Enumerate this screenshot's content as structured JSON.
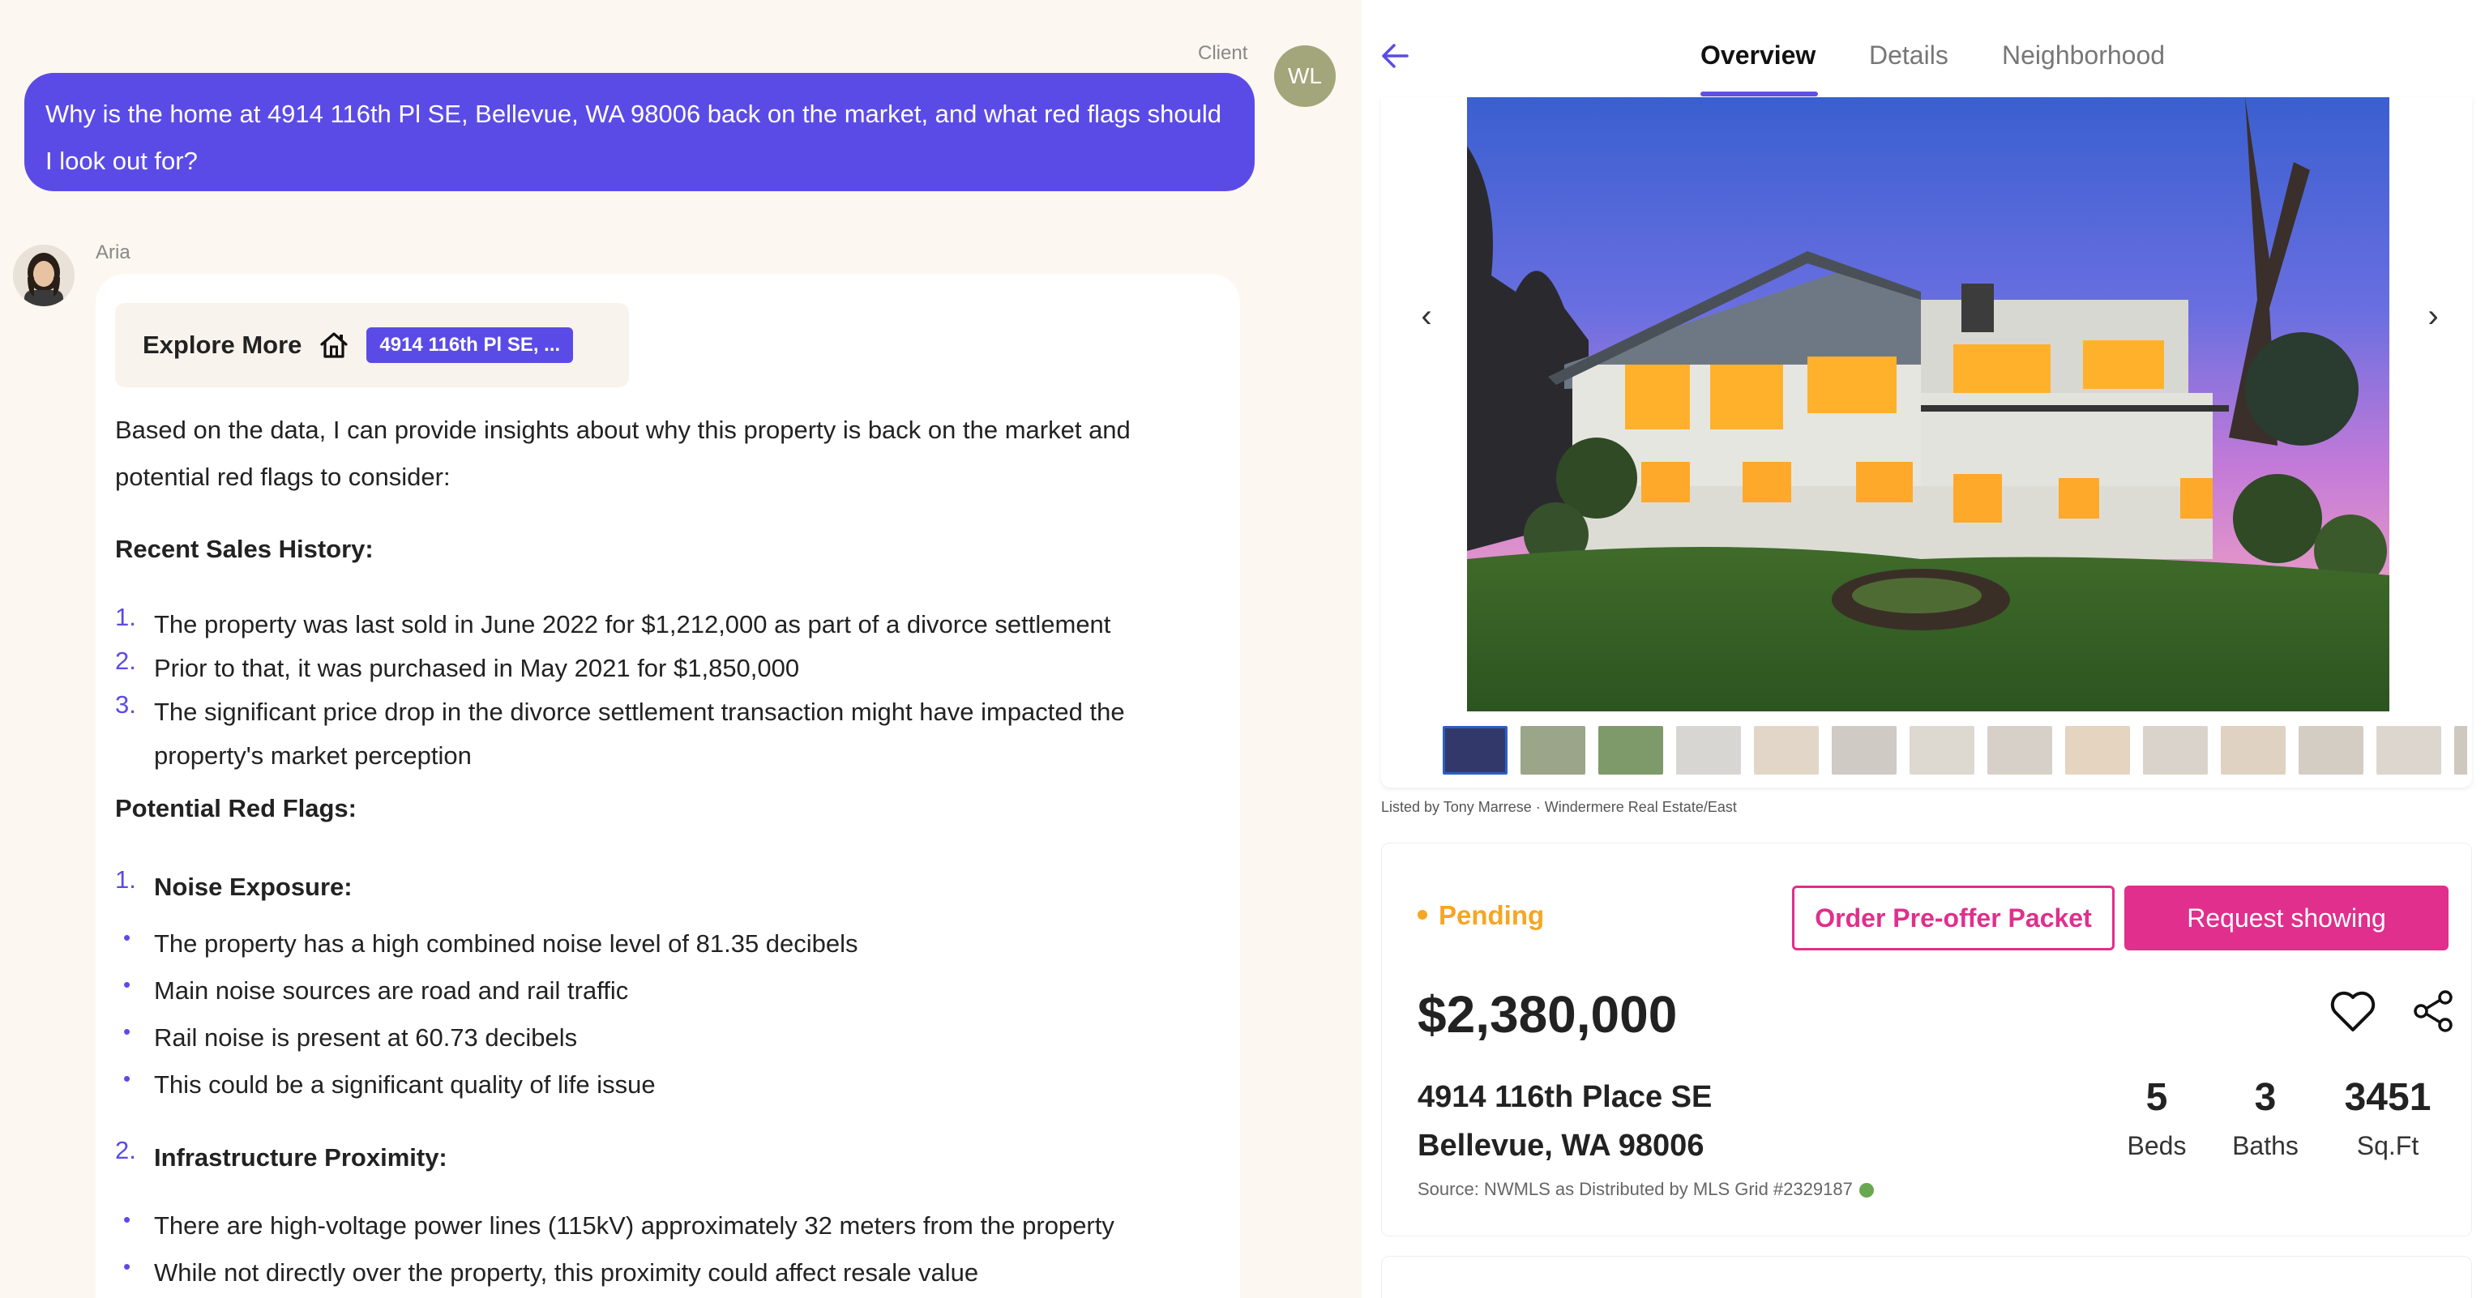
{
  "chat": {
    "client_label": "Client",
    "client_initials": "WL",
    "question": "Why is the home at 4914 116th Pl SE, Bellevue, WA 98006 back on the market, and what red flags should I look out for?",
    "assistant_name": "Aria",
    "explore": {
      "label": "Explore More",
      "chip": "4914 116th Pl SE, ..."
    },
    "intro": "Based on the data, I can provide insights about why this property is back on the market and potential red flags to consider:",
    "sales_heading": "Recent Sales History:",
    "sales_items": [
      {
        "n": "1.",
        "text": "The property was last sold in June 2022 for $1,212,000 as part of a divorce settlement"
      },
      {
        "n": "2.",
        "text": "Prior to that, it was purchased in May 2021 for $1,850,000"
      },
      {
        "n": "3.",
        "text": "The significant price drop in the divorce settlement transaction might have impacted the property's market perception"
      }
    ],
    "flags_heading": "Potential Red Flags:",
    "flag1": {
      "n": "1.",
      "title": "Noise Exposure:"
    },
    "flag1_bullets": [
      "The property has a high combined noise level of 81.35 decibels",
      "Main noise sources are road and rail traffic",
      "Rail noise is present at 60.73 decibels",
      "This could be a significant quality of life issue"
    ],
    "flag2": {
      "n": "2.",
      "title": "Infrastructure Proximity:"
    },
    "flag2_bullets": [
      "There are high-voltage power lines (115kV) approximately 32 meters from the property",
      "While not directly over the property, this proximity could affect resale value"
    ]
  },
  "panel": {
    "tabs": [
      "Overview",
      "Details",
      "Neighborhood"
    ],
    "active_tab": "Overview",
    "listed_by": "Listed by Tony Marrese · Windermere Real Estate/East",
    "status": "Pending",
    "order_button": "Order Pre-offer Packet",
    "request_button": "Request showing",
    "price": "$2,380,000",
    "address_line1": "4914 116th Place SE",
    "address_line2": "Bellevue, WA 98006",
    "source": "Source: NWMLS as Distributed by MLS Grid #2329187",
    "stats": [
      {
        "value": "5",
        "label": "Beds"
      },
      {
        "value": "3",
        "label": "Baths"
      },
      {
        "value": "3451",
        "label": "Sq.Ft"
      }
    ]
  },
  "colors": {
    "accent": "#5b4be6",
    "pink": "#e02f8c",
    "pending": "#f5a623",
    "background": "#fcf7f0"
  }
}
